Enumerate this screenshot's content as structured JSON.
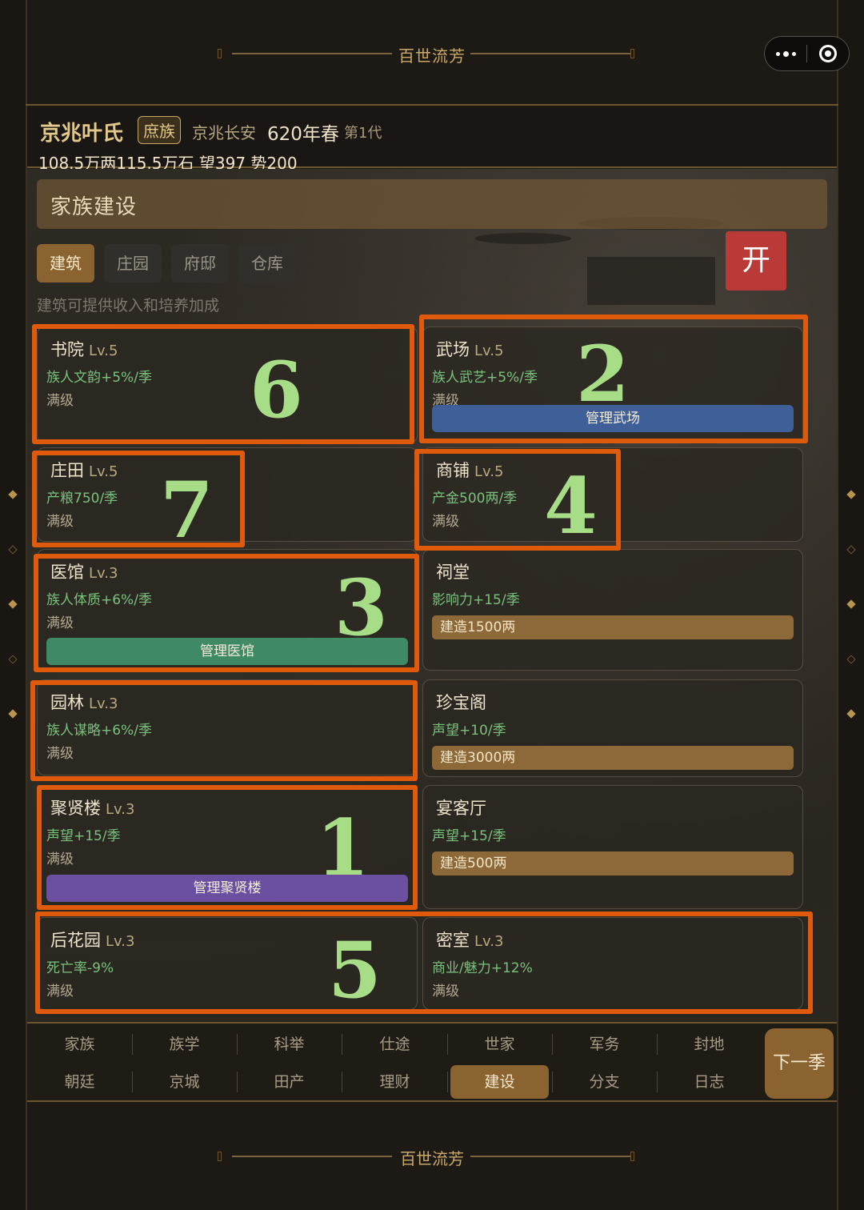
{
  "app": {
    "title": "百世流芳",
    "footer_title": "百世流芳"
  },
  "header": {
    "family_name": "京兆叶氏",
    "rank_badge": "庶族",
    "location": "京兆长安",
    "date": "620年春",
    "generation": "第1代",
    "stats": "108.5万两115.5万石 望397 势200"
  },
  "section": {
    "title": "家族建设",
    "hint": "建筑可提供收入和培养加成",
    "open_label": "开",
    "tabs": [
      {
        "label": "建筑",
        "active": true
      },
      {
        "label": "庄园",
        "active": false
      },
      {
        "label": "府邸",
        "active": false
      },
      {
        "label": "仓库",
        "active": false
      }
    ]
  },
  "buildings": [
    {
      "name": "书院",
      "level": "Lv.5",
      "effect": "族人文韵+5%/季",
      "status": "满级"
    },
    {
      "name": "武场",
      "level": "Lv.5",
      "effect": "族人武艺+5%/季",
      "status": "满级",
      "action": "管理武场",
      "action_color": "#3e5f98"
    },
    {
      "name": "庄田",
      "level": "Lv.5",
      "effect": "产粮750/季",
      "status": "满级"
    },
    {
      "name": "商铺",
      "level": "Lv.5",
      "effect": "产金500两/季",
      "status": "满级"
    },
    {
      "name": "医馆",
      "level": "Lv.3",
      "effect": "族人体质+6%/季",
      "status": "满级",
      "action": "管理医馆",
      "action_color": "#3f8a64"
    },
    {
      "name": "祠堂",
      "level": "",
      "effect": "影响力+15/季",
      "build": "建造1500两"
    },
    {
      "name": "园林",
      "level": "Lv.3",
      "effect": "族人谋略+6%/季",
      "status": "满级"
    },
    {
      "name": "珍宝阁",
      "level": "",
      "effect": "声望+10/季",
      "build": "建造3000两"
    },
    {
      "name": "聚贤楼",
      "level": "Lv.3",
      "effect": "声望+15/季",
      "status": "满级",
      "action": "管理聚贤楼",
      "action_color": "#6b4fa0"
    },
    {
      "name": "宴客厅",
      "level": "",
      "effect": "声望+15/季",
      "build": "建造500两"
    },
    {
      "name": "后花园",
      "level": "Lv.3",
      "effect": "死亡率-9%",
      "status": "满级"
    },
    {
      "name": "密室",
      "level": "Lv.3",
      "effect": "商业/魅力+12%",
      "status": "满级"
    }
  ],
  "annotations": [
    "6",
    "2",
    "7",
    "4",
    "3",
    "1",
    "5"
  ],
  "bottom_nav": {
    "row1": [
      "家族",
      "族学",
      "科举",
      "仕途",
      "世家",
      "军务",
      "封地"
    ],
    "row2": [
      "朝廷",
      "京城",
      "田产",
      "理财",
      "建设",
      "分支",
      "日志"
    ],
    "active": "建设",
    "next_label": "下一季"
  },
  "colors": {
    "accent": "#8a6330",
    "gold_text": "#c9a869",
    "effect_green": "#79c27d",
    "annotation_orange": "#e05a0c",
    "annotation_digit": "#a8dd88"
  }
}
